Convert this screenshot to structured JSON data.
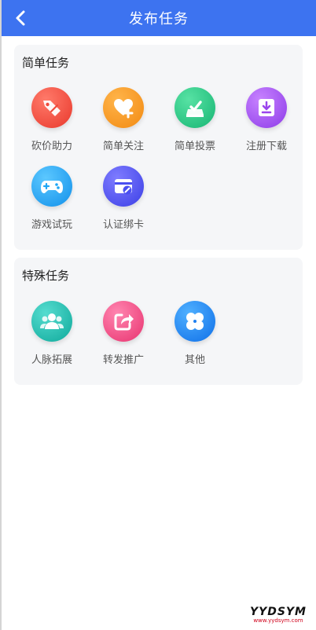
{
  "header": {
    "title": "发布任务",
    "back_icon": "chevron-left-icon",
    "color": "#3d73f0"
  },
  "sections": [
    {
      "title": "简单任务",
      "items": [
        {
          "label": "砍价助力",
          "icon": "price-tag-icon",
          "color": "#f0493e"
        },
        {
          "label": "简单关注",
          "icon": "heart-plus-icon",
          "color": "#f7941e"
        },
        {
          "label": "简单投票",
          "icon": "vote-box-icon",
          "color": "#26c483"
        },
        {
          "label": "注册下载",
          "icon": "download-icon",
          "color": "#a14ff0"
        },
        {
          "label": "游戏试玩",
          "icon": "gamepad-icon",
          "color": "#1ea6f5"
        },
        {
          "label": "认证绑卡",
          "icon": "card-link-icon",
          "color": "#4a4ff0"
        }
      ]
    },
    {
      "title": "特殊任务",
      "items": [
        {
          "label": "人脉拓展",
          "icon": "people-icon",
          "color": "#1fbfb0"
        },
        {
          "label": "转发推广",
          "icon": "share-icon",
          "color": "#f04f8a"
        },
        {
          "label": "其他",
          "icon": "clover-icon",
          "color": "#1f7ff0"
        }
      ]
    }
  ],
  "watermark": {
    "main": "YYDSYM",
    "sub": "www.yydsym.com"
  }
}
